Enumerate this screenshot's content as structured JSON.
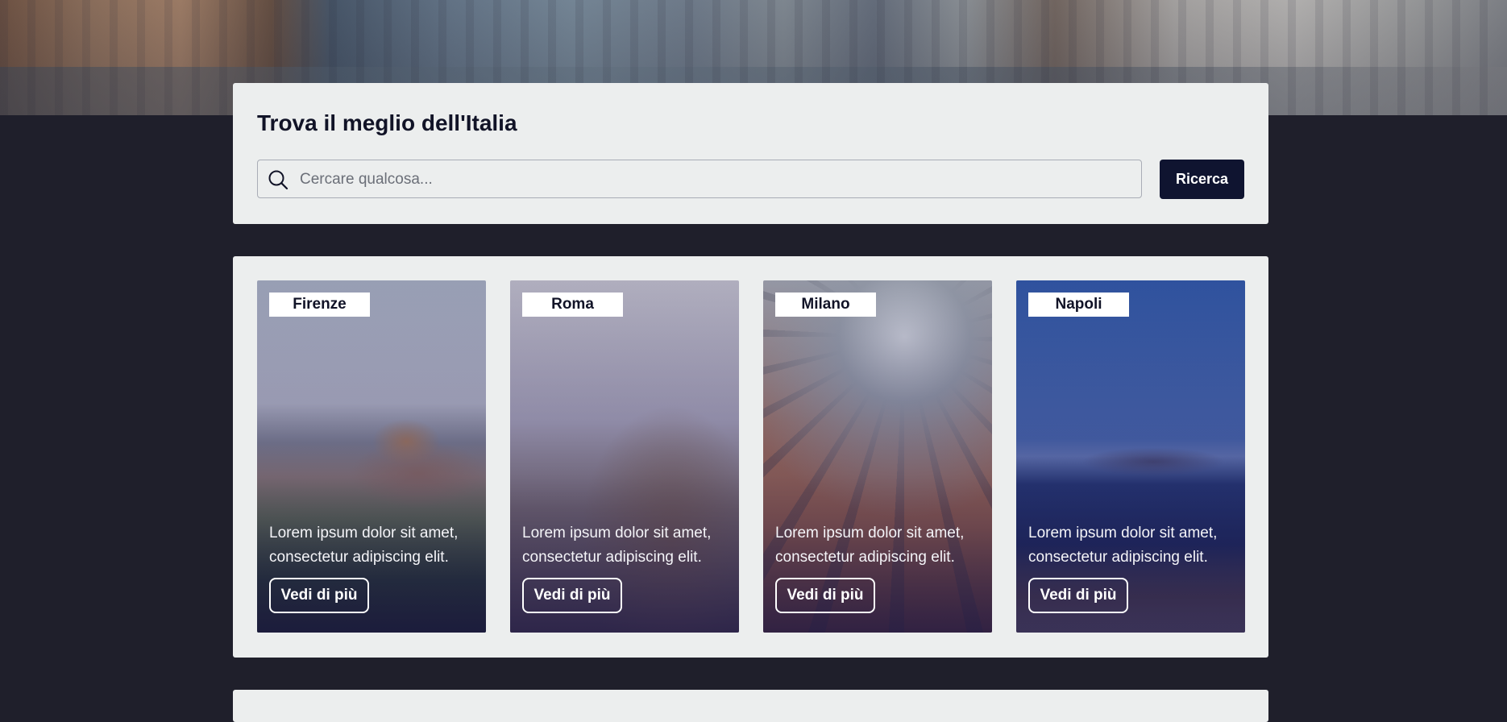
{
  "search": {
    "title": "Trova il meglio dell'Italia",
    "placeholder": "Cercare qualcosa...",
    "button_label": "Ricerca",
    "icon": "search-icon"
  },
  "cards": [
    {
      "city": "Firenze",
      "description": "Lorem ipsum dolor sit amet, consectetur adipiscing elit.",
      "button_label": "Vedi di più"
    },
    {
      "city": "Roma",
      "description": "Lorem ipsum dolor sit amet, consectetur adipiscing elit.",
      "button_label": "Vedi di più"
    },
    {
      "city": "Milano",
      "description": "Lorem ipsum dolor sit amet, consectetur adipiscing elit.",
      "button_label": "Vedi di più"
    },
    {
      "city": "Napoli",
      "description": "Lorem ipsum dolor sit amet, consectetur adipiscing elit.",
      "button_label": "Vedi di più"
    }
  ],
  "colors": {
    "page_background": "#1f1f2b",
    "panel_background": "#eceeee",
    "primary_button": "#0f1430",
    "heading_text": "#111327"
  }
}
